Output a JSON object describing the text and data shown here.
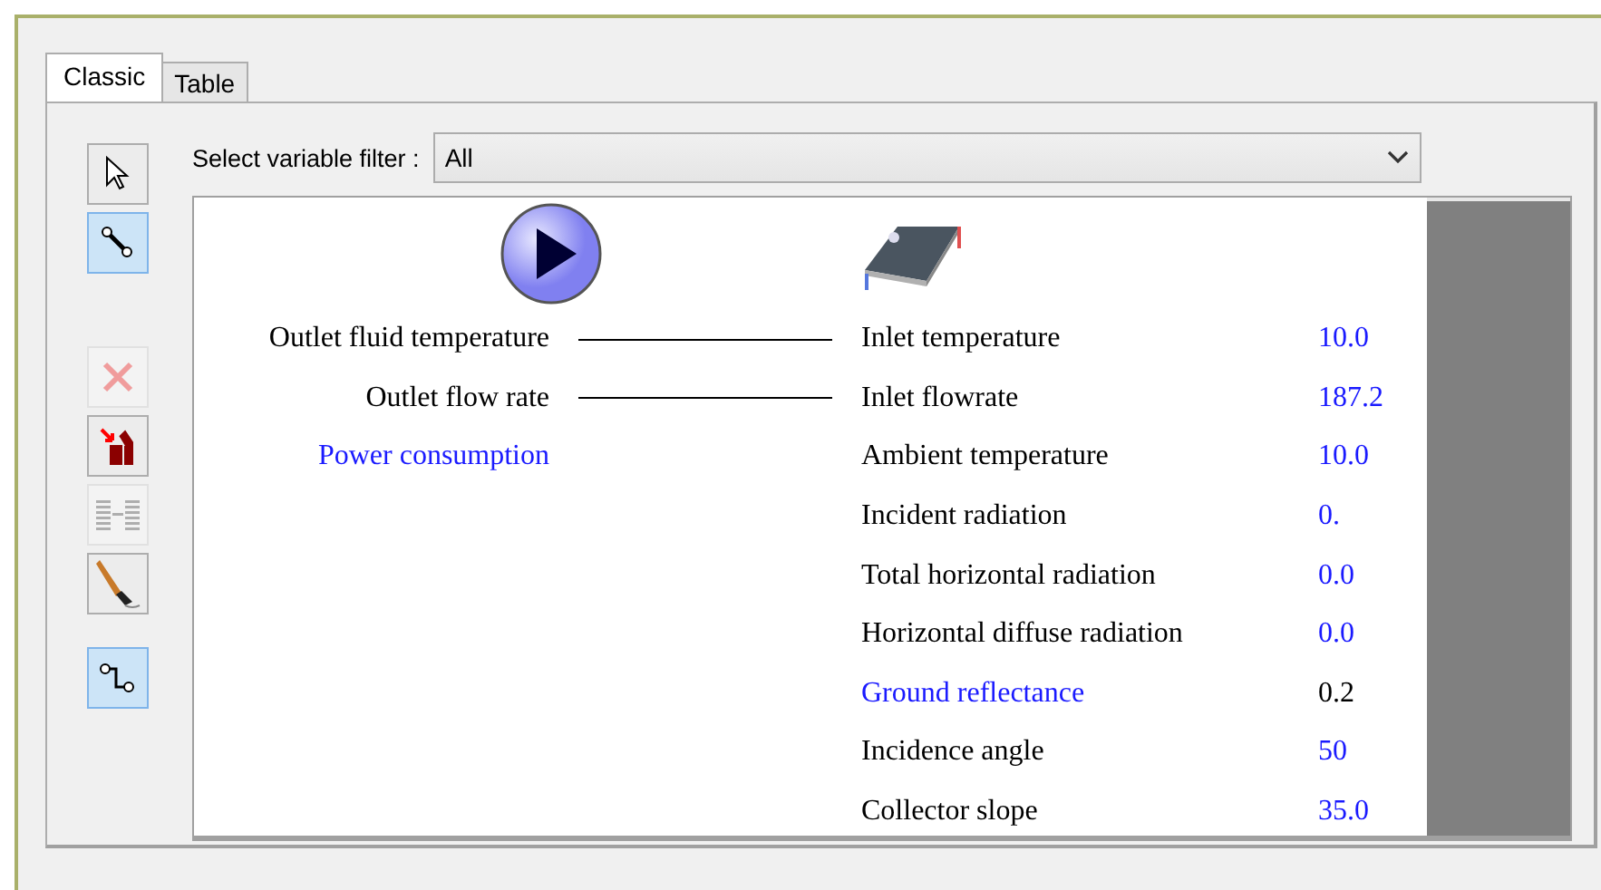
{
  "tabs": [
    {
      "label": "Classic",
      "selected": true
    },
    {
      "label": "Table",
      "selected": false
    }
  ],
  "tools": [
    {
      "kind": "pointer",
      "selected": false,
      "disabled": false
    },
    {
      "kind": "connect",
      "selected": true,
      "disabled": false
    },
    {
      "kind": "delete",
      "selected": false,
      "disabled": true
    },
    {
      "kind": "export",
      "selected": false,
      "disabled": false
    },
    {
      "kind": "align",
      "selected": false,
      "disabled": true
    },
    {
      "kind": "paint",
      "selected": false,
      "disabled": false
    },
    {
      "kind": "link",
      "selected": true,
      "disabled": false
    }
  ],
  "filter": {
    "label": "Select variable filter :",
    "value": "All"
  },
  "outputs": [
    {
      "name": "Outlet fluid temperature",
      "connected": true,
      "highlighted": false
    },
    {
      "name": "Outlet flow rate",
      "connected": true,
      "highlighted": false
    },
    {
      "name": "Power consumption",
      "connected": false,
      "highlighted": true
    }
  ],
  "inputs": [
    {
      "name": "Inlet temperature",
      "value": "10.0",
      "highlighted": false,
      "value_highlighted": true
    },
    {
      "name": "Inlet flowrate",
      "value": "187.2",
      "highlighted": false,
      "value_highlighted": true
    },
    {
      "name": "Ambient temperature",
      "value": "10.0",
      "highlighted": false,
      "value_highlighted": true
    },
    {
      "name": "Incident radiation",
      "value": "0.",
      "highlighted": false,
      "value_highlighted": true
    },
    {
      "name": "Total horizontal radiation",
      "value": "0.0",
      "highlighted": false,
      "value_highlighted": true
    },
    {
      "name": "Horizontal diffuse radiation",
      "value": "0.0",
      "highlighted": false,
      "value_highlighted": true
    },
    {
      "name": "Ground reflectance",
      "value": "0.2",
      "highlighted": true,
      "value_highlighted": false
    },
    {
      "name": "Incidence angle",
      "value": "50",
      "highlighted": false,
      "value_highlighted": true
    },
    {
      "name": "Collector slope",
      "value": "35.0",
      "highlighted": false,
      "value_highlighted": true
    }
  ]
}
